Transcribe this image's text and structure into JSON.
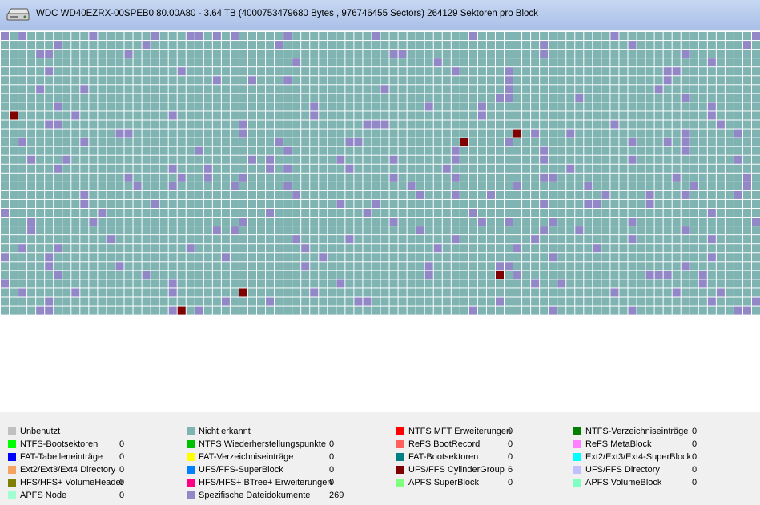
{
  "header": {
    "title": "WDC WD40EZRX-00SPEB0 80.00A80 - 3.64 TB (4000753479680 Bytes , 976746455 Sectors) 264129 Sektoren pro Block"
  },
  "colors": {
    "not_recognized": "#7fb4b2",
    "specific_file": "#9388c7",
    "cylinder_group": "#800000",
    "grid_line": "#ffffff"
  },
  "block_map": {
    "rows": 32,
    "cols": 86,
    "specific_file_blocks": [
      [
        0,
        0
      ],
      [
        0,
        2
      ],
      [
        0,
        10
      ],
      [
        0,
        17
      ],
      [
        0,
        21
      ],
      [
        0,
        22
      ],
      [
        0,
        24
      ],
      [
        0,
        26
      ],
      [
        0,
        32
      ],
      [
        0,
        42
      ],
      [
        0,
        53
      ],
      [
        0,
        69
      ],
      [
        0,
        85
      ],
      [
        1,
        6
      ],
      [
        1,
        16
      ],
      [
        1,
        31
      ],
      [
        1,
        61
      ],
      [
        1,
        71
      ],
      [
        1,
        84
      ],
      [
        2,
        4
      ],
      [
        2,
        5
      ],
      [
        2,
        14
      ],
      [
        2,
        44
      ],
      [
        2,
        45
      ],
      [
        2,
        61
      ],
      [
        2,
        77
      ],
      [
        3,
        33
      ],
      [
        3,
        49
      ],
      [
        3,
        80
      ],
      [
        4,
        5
      ],
      [
        4,
        20
      ],
      [
        4,
        51
      ],
      [
        4,
        57
      ],
      [
        4,
        75
      ],
      [
        4,
        76
      ],
      [
        5,
        24
      ],
      [
        5,
        28
      ],
      [
        5,
        32
      ],
      [
        5,
        57
      ],
      [
        5,
        75
      ],
      [
        6,
        4
      ],
      [
        6,
        9
      ],
      [
        6,
        43
      ],
      [
        6,
        57
      ],
      [
        6,
        74
      ],
      [
        7,
        56
      ],
      [
        7,
        57
      ],
      [
        7,
        65
      ],
      [
        7,
        77
      ],
      [
        8,
        6
      ],
      [
        8,
        35
      ],
      [
        8,
        48
      ],
      [
        8,
        54
      ],
      [
        8,
        80
      ],
      [
        9,
        1
      ],
      [
        9,
        8
      ],
      [
        9,
        19
      ],
      [
        9,
        35
      ],
      [
        9,
        54
      ],
      [
        9,
        80
      ],
      [
        10,
        5
      ],
      [
        10,
        6
      ],
      [
        10,
        27
      ],
      [
        10,
        41
      ],
      [
        10,
        42
      ],
      [
        10,
        43
      ],
      [
        10,
        69
      ],
      [
        10,
        81
      ],
      [
        11,
        13
      ],
      [
        11,
        14
      ],
      [
        11,
        27
      ],
      [
        11,
        60
      ],
      [
        11,
        64
      ],
      [
        11,
        77
      ],
      [
        11,
        83
      ],
      [
        12,
        2
      ],
      [
        12,
        9
      ],
      [
        12,
        31
      ],
      [
        12,
        39
      ],
      [
        12,
        40
      ],
      [
        12,
        52
      ],
      [
        12,
        57
      ],
      [
        12,
        71
      ],
      [
        12,
        75
      ],
      [
        12,
        77
      ],
      [
        13,
        22
      ],
      [
        13,
        32
      ],
      [
        13,
        51
      ],
      [
        13,
        61
      ],
      [
        13,
        77
      ],
      [
        14,
        3
      ],
      [
        14,
        7
      ],
      [
        14,
        28
      ],
      [
        14,
        30
      ],
      [
        14,
        38
      ],
      [
        14,
        44
      ],
      [
        14,
        51
      ],
      [
        14,
        61
      ],
      [
        14,
        71
      ],
      [
        14,
        83
      ],
      [
        15,
        6
      ],
      [
        15,
        19
      ],
      [
        15,
        23
      ],
      [
        15,
        30
      ],
      [
        15,
        32
      ],
      [
        15,
        39
      ],
      [
        15,
        50
      ],
      [
        15,
        64
      ],
      [
        16,
        14
      ],
      [
        16,
        20
      ],
      [
        16,
        23
      ],
      [
        16,
        27
      ],
      [
        16,
        44
      ],
      [
        16,
        51
      ],
      [
        16,
        61
      ],
      [
        16,
        62
      ],
      [
        16,
        76
      ],
      [
        16,
        84
      ],
      [
        17,
        15
      ],
      [
        17,
        19
      ],
      [
        17,
        26
      ],
      [
        17,
        32
      ],
      [
        17,
        46
      ],
      [
        17,
        58
      ],
      [
        17,
        66
      ],
      [
        17,
        78
      ],
      [
        17,
        84
      ],
      [
        18,
        9
      ],
      [
        18,
        33
      ],
      [
        18,
        47
      ],
      [
        18,
        51
      ],
      [
        18,
        55
      ],
      [
        18,
        68
      ],
      [
        18,
        73
      ],
      [
        18,
        77
      ],
      [
        18,
        83
      ],
      [
        19,
        9
      ],
      [
        19,
        17
      ],
      [
        19,
        38
      ],
      [
        19,
        42
      ],
      [
        19,
        61
      ],
      [
        19,
        66
      ],
      [
        19,
        67
      ],
      [
        19,
        73
      ],
      [
        20,
        0
      ],
      [
        20,
        11
      ],
      [
        20,
        30
      ],
      [
        20,
        41
      ],
      [
        20,
        53
      ],
      [
        20,
        80
      ],
      [
        21,
        3
      ],
      [
        21,
        10
      ],
      [
        21,
        27
      ],
      [
        21,
        44
      ],
      [
        21,
        54
      ],
      [
        21,
        57
      ],
      [
        21,
        62
      ],
      [
        21,
        71
      ],
      [
        21,
        85
      ],
      [
        22,
        3
      ],
      [
        22,
        24
      ],
      [
        22,
        26
      ],
      [
        22,
        47
      ],
      [
        22,
        61
      ],
      [
        22,
        65
      ],
      [
        22,
        77
      ],
      [
        23,
        12
      ],
      [
        23,
        33
      ],
      [
        23,
        39
      ],
      [
        23,
        51
      ],
      [
        23,
        60
      ],
      [
        23,
        71
      ],
      [
        23,
        80
      ],
      [
        24,
        2
      ],
      [
        24,
        6
      ],
      [
        24,
        21
      ],
      [
        24,
        34
      ],
      [
        24,
        49
      ],
      [
        24,
        58
      ],
      [
        24,
        67
      ],
      [
        25,
        0
      ],
      [
        25,
        5
      ],
      [
        25,
        25
      ],
      [
        25,
        36
      ],
      [
        25,
        62
      ],
      [
        25,
        80
      ],
      [
        26,
        5
      ],
      [
        26,
        13
      ],
      [
        26,
        34
      ],
      [
        26,
        48
      ],
      [
        26,
        56
      ],
      [
        26,
        57
      ],
      [
        26,
        77
      ],
      [
        27,
        6
      ],
      [
        27,
        16
      ],
      [
        27,
        48
      ],
      [
        27,
        58
      ],
      [
        27,
        73
      ],
      [
        27,
        74
      ],
      [
        27,
        75
      ],
      [
        27,
        79
      ],
      [
        28,
        0
      ],
      [
        28,
        19
      ],
      [
        28,
        38
      ],
      [
        28,
        60
      ],
      [
        28,
        63
      ],
      [
        28,
        79
      ],
      [
        29,
        2
      ],
      [
        29,
        8
      ],
      [
        29,
        19
      ],
      [
        29,
        35
      ],
      [
        29,
        69
      ],
      [
        29,
        76
      ],
      [
        29,
        81
      ],
      [
        30,
        5
      ],
      [
        30,
        25
      ],
      [
        30,
        30
      ],
      [
        30,
        40
      ],
      [
        30,
        41
      ],
      [
        30,
        56
      ],
      [
        30,
        80
      ],
      [
        30,
        85
      ],
      [
        31,
        4
      ],
      [
        31,
        5
      ],
      [
        31,
        19
      ],
      [
        31,
        22
      ],
      [
        31,
        53
      ],
      [
        31,
        62
      ],
      [
        31,
        71
      ],
      [
        31,
        83
      ],
      [
        31,
        84
      ]
    ],
    "cylinder_group_blocks": [
      [
        9,
        1
      ],
      [
        11,
        58
      ],
      [
        12,
        52
      ],
      [
        27,
        56
      ],
      [
        29,
        27
      ],
      [
        31,
        20
      ]
    ]
  },
  "legend": [
    {
      "label": "Unbenutzt",
      "count": "",
      "color": "#c0c0c0"
    },
    {
      "label": "Nicht erkannt",
      "count": "",
      "color": "#7fb4b2"
    },
    {
      "label": "NTFS MFT Erweiterungen",
      "count": "0",
      "color": "#ff0000"
    },
    {
      "label": "NTFS-Verzeichniseinträge",
      "count": "0",
      "color": "#008000"
    },
    {
      "label": "NTFS-Bootsektoren",
      "count": "0",
      "color": "#00ff00"
    },
    {
      "label": "NTFS Wiederherstellungspunkte",
      "count": "0",
      "color": "#00c000"
    },
    {
      "label": "ReFS BootRecord",
      "count": "0",
      "color": "#ff6060"
    },
    {
      "label": "ReFS MetaBlock",
      "count": "0",
      "color": "#ff80ff"
    },
    {
      "label": "FAT-Tabelleneinträge",
      "count": "0",
      "color": "#0000ff"
    },
    {
      "label": "FAT-Verzeichniseinträge",
      "count": "0",
      "color": "#ffff00"
    },
    {
      "label": "FAT-Bootsektoren",
      "count": "0",
      "color": "#008080"
    },
    {
      "label": "Ext2/Ext3/Ext4-SuperBlock",
      "count": "0",
      "color": "#00ffff"
    },
    {
      "label": "Ext2/Ext3/Ext4 Directory",
      "count": "0",
      "color": "#f4a460"
    },
    {
      "label": "UFS/FFS-SuperBlock",
      "count": "0",
      "color": "#0080ff"
    },
    {
      "label": "UFS/FFS CylinderGroup",
      "count": "6",
      "color": "#800000"
    },
    {
      "label": "UFS/FFS Directory",
      "count": "0",
      "color": "#c0c0ff"
    },
    {
      "label": "HFS/HFS+ VolumeHeader",
      "count": "0",
      "color": "#808000"
    },
    {
      "label": "HFS/HFS+ BTree+ Erweiterungen",
      "count": "0",
      "color": "#ff0080"
    },
    {
      "label": "APFS SuperBlock",
      "count": "0",
      "color": "#80ff80"
    },
    {
      "label": "APFS VolumeBlock",
      "count": "0",
      "color": "#80ffc0"
    },
    {
      "label": "APFS Node",
      "count": "0",
      "color": "#a0ffd0"
    },
    {
      "label": "Spezifische Dateidokumente",
      "count": "269",
      "color": "#9388c7"
    }
  ]
}
